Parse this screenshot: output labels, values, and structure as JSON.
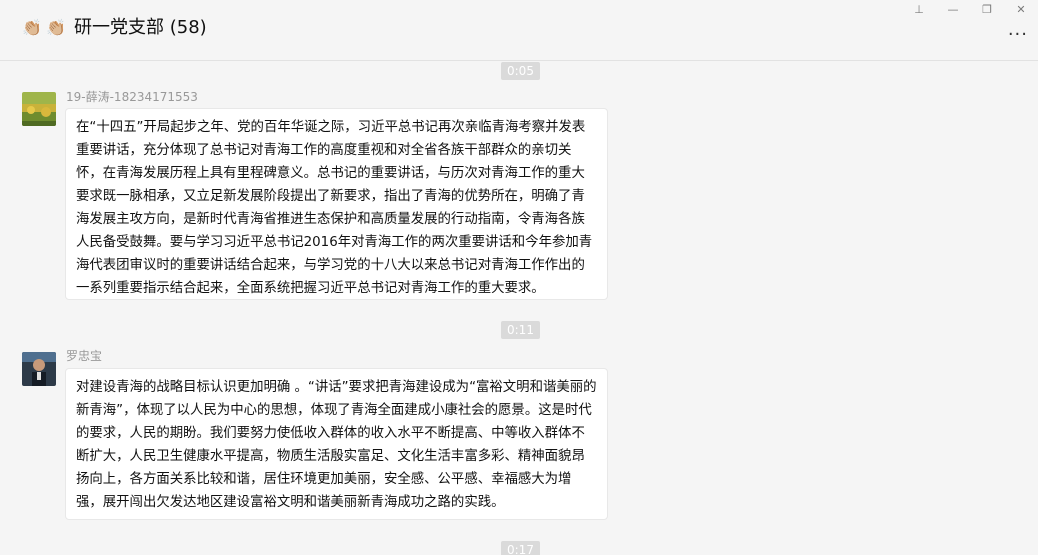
{
  "header": {
    "emojis": [
      "👏🏼",
      "👏🏼"
    ],
    "title": "研一党支部 (58)"
  },
  "window_controls": {
    "pin_icon": "pin-icon",
    "minimize_icon": "minimize-icon",
    "restore_icon": "restore-icon",
    "close_icon": "close-icon",
    "pin_glyph": "⊥",
    "minimize_glyph": "—",
    "restore_glyph": "❐",
    "close_glyph": "✕"
  },
  "more_button": {
    "glyph": "···"
  },
  "messages": [
    {
      "time": "0:05",
      "sender": "19-薛涛-18234171553",
      "text": "在“十四五”开局起步之年、党的百年华诞之际，习近平总书记再次亲临青海考察并发表重要讲话，充分体现了总书记对青海工作的高度重视和对全省各族干部群众的亲切关怀，在青海发展历程上具有里程碑意义。总书记的重要讲话，与历次对青海工作的重大要求既一脉相承，又立足新发展阶段提出了新要求，指出了青海的优势所在，明确了青海发展主攻方向，是新时代青海省推进生态保护和高质量发展的行动指南，令青海各族人民备受鼓舞。要与学习习近平总书记2016年对青海工作的两次重要讲话和今年参加青海代表团审议时的重要讲话结合起来，与学习党的十八大以来总书记对青海工作作出的一系列重要指示结合起来，全面系统把握习近平总书记对青海工作的重大要求。"
    },
    {
      "time": "0:11",
      "sender": "罗忠宝",
      "text": "对建设青海的战略目标认识更加明确 。“讲话”要求把青海建设成为“富裕文明和谐美丽的新青海”，体现了以人民为中心的思想，体现了青海全面建成小康社会的愿景。这是时代的要求，人民的期盼。我们要努力使低收入群体的收入水平不断提高、中等收入群体不断扩大，人民卫生健康水平提高，物质生活殷实富足、文化生活丰富多彩、精神面貌昂扬向上，各方面关系比较和谐，居住环境更加美丽，安全感、公平感、幸福感大为增强，展开闯出欠发达地区建设富裕文明和谐美丽新青海成功之路的实践。"
    },
    {
      "time": "0:17"
    }
  ]
}
